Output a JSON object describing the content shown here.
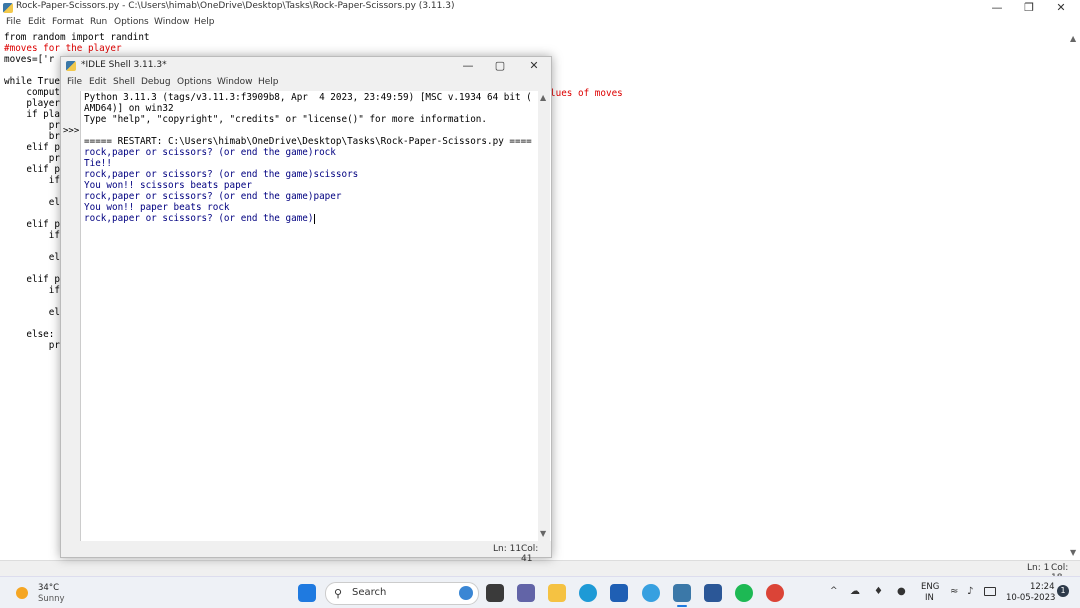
{
  "editor": {
    "title": "Rock-Paper-Scissors.py - C:\\Users\\himab\\OneDrive\\Desktop\\Tasks\\Rock-Paper-Scissors.py (3.11.3)",
    "menu": [
      "File",
      "Edit",
      "Format",
      "Run",
      "Options",
      "Window",
      "Help"
    ],
    "code_lines": [
      "from random import randint",
      "#moves for the player",
      "moves=['r",
      "",
      "while True",
      "    comput",
      "    player",
      "    if pla",
      "        pr",
      "        br",
      "    elif p",
      "        pr",
      "    elif p",
      "        if",
      "",
      "        el",
      "",
      "    elif p",
      "        if",
      "",
      "        el",
      "",
      "    elif p",
      "        if",
      "",
      "        el",
      "",
      "    else:",
      "        pr"
    ],
    "right_fragment": "lues of moves",
    "status": {
      "ln": "Ln: 1",
      "col": "Col: 18"
    }
  },
  "shell": {
    "title": "*IDLE Shell 3.11.3*",
    "menu": [
      "File",
      "Edit",
      "Shell",
      "Debug",
      "Options",
      "Window",
      "Help"
    ],
    "prompt": ">>>",
    "lines": [
      "Python 3.11.3 (tags/v3.11.3:f3909b8, Apr  4 2023, 23:49:59) [MSC v.1934 64 bit (",
      "AMD64)] on win32",
      "Type \"help\", \"copyright\", \"credits\" or \"license()\" for more information.",
      "",
      "===== RESTART: C:\\Users\\himab\\OneDrive\\Desktop\\Tasks\\Rock-Paper-Scissors.py ====",
      "rock,paper or scissors? (or end the game)rock",
      "Tie!!",
      "rock,paper or scissors? (or end the game)scissors",
      "You won!! scissors beats paper",
      "rock,paper or scissors? (or end the game)paper",
      "You won!! paper beats rock",
      "rock,paper or scissors? (or end the game)"
    ],
    "status": {
      "ln": "Ln: 11",
      "col": "Col: 41"
    }
  },
  "taskbar": {
    "weather_temp": "34°C",
    "weather_desc": "Sunny",
    "search_label": "Search",
    "lang_top": "ENG",
    "lang_bottom": "IN",
    "time": "12:24",
    "date": "10-05-2023",
    "notification_count": "1"
  }
}
